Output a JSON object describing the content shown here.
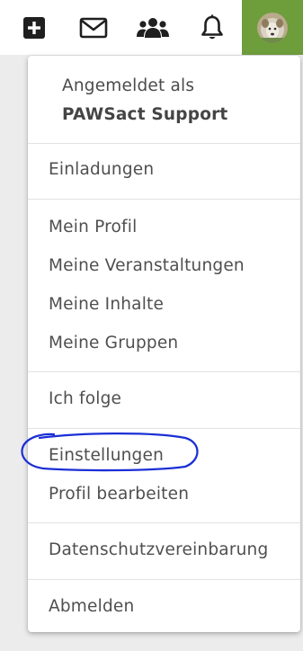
{
  "topbar": {
    "icons": {
      "create": "plus-square-icon",
      "messages": "envelope-icon",
      "groups": "people-group-icon",
      "notifications": "bell-icon",
      "profile": "user-avatar"
    },
    "accent_color": "#6e9d3c"
  },
  "user_menu": {
    "signed_in_prefix": "Angemeldet als",
    "user_name": "PAWSact Support",
    "sections": [
      {
        "items": [
          {
            "label": "Einladungen"
          }
        ]
      },
      {
        "items": [
          {
            "label": "Mein Profil"
          },
          {
            "label": "Meine Veranstaltungen"
          },
          {
            "label": "Meine Inhalte"
          },
          {
            "label": "Meine Gruppen"
          }
        ]
      },
      {
        "items": [
          {
            "label": "Ich folge"
          }
        ]
      },
      {
        "items": [
          {
            "label": "Einstellungen",
            "highlighted": true
          },
          {
            "label": "Profil bearbeiten"
          }
        ]
      },
      {
        "items": [
          {
            "label": "Datenschutzvereinbarung"
          }
        ]
      },
      {
        "items": [
          {
            "label": "Abmelden"
          }
        ]
      }
    ]
  },
  "annotation": {
    "type": "hand-drawn ellipse",
    "target": "Einstellungen",
    "color": "#1b2fd6"
  }
}
